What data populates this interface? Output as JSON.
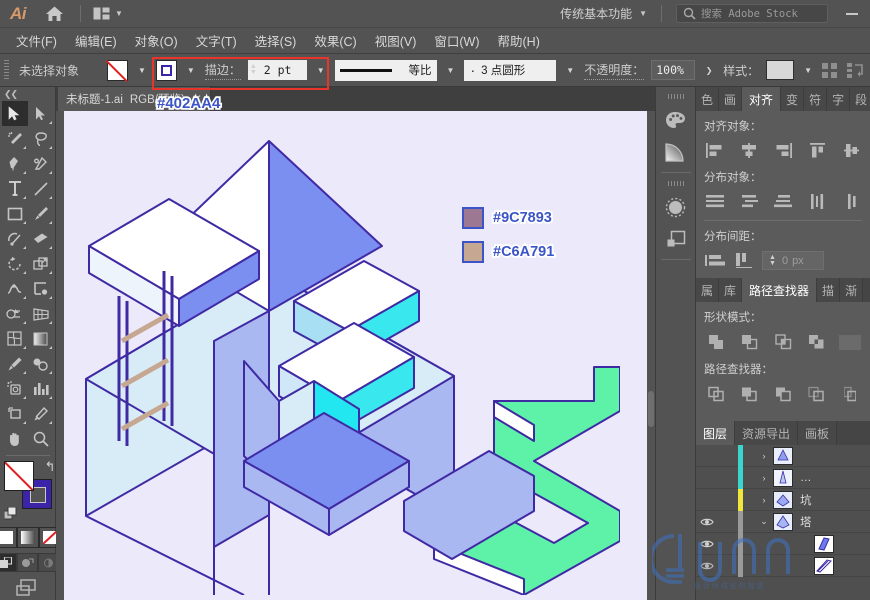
{
  "app": {
    "logo": "Ai",
    "home_icon": "home-icon",
    "arrange_icon": "arrange-documents-icon",
    "workspace": "传统基本功能",
    "search_placeholder": "搜索 Adobe Stock",
    "search_icon": "search-icon",
    "minimize_label": "—"
  },
  "menubar": {
    "items": [
      {
        "label": "文件(F)",
        "name": "menu-file"
      },
      {
        "label": "编辑(E)",
        "name": "menu-edit"
      },
      {
        "label": "对象(O)",
        "name": "menu-object"
      },
      {
        "label": "文字(T)",
        "name": "menu-type"
      },
      {
        "label": "选择(S)",
        "name": "menu-select"
      },
      {
        "label": "效果(C)",
        "name": "menu-effect"
      },
      {
        "label": "视图(V)",
        "name": "menu-view"
      },
      {
        "label": "窗口(W)",
        "name": "menu-window"
      },
      {
        "label": "帮助(H)",
        "name": "menu-help"
      }
    ]
  },
  "controlbar": {
    "selection_status": "未选择对象",
    "fill_swatch": "none",
    "stroke_label": "描边：",
    "stroke_width": "2 pt",
    "profile_label": "等比",
    "brush_label": "3 点圆形",
    "opacity_label": "不透明度：",
    "opacity_value": "100%",
    "style_label": "样式：",
    "align_icon": "align-panel-icon",
    "transform_icon": "transform-panel-icon"
  },
  "document": {
    "tab_title": "未标题-1.ai",
    "tab_mode": "RGB/预览)",
    "tab_close": "✕",
    "hex_annotation": "#402AA4"
  },
  "canvas": {
    "background": "#ece9fb",
    "stroke_color": "#402AA4",
    "legend": [
      {
        "hex": "#9C7893",
        "swatch": "#9C7893"
      },
      {
        "hex": "#C6A791",
        "swatch": "#C6A791"
      }
    ]
  },
  "toolbar": {
    "collapse_icon": "collapse-toolbar-icon",
    "tools": [
      {
        "name": "selection-tool",
        "active": true
      },
      {
        "name": "direct-selection-tool",
        "active": false
      },
      {
        "name": "magic-wand-tool",
        "active": false
      },
      {
        "name": "lasso-tool",
        "active": false
      },
      {
        "name": "pen-tool",
        "active": false
      },
      {
        "name": "curvature-tool",
        "active": false
      },
      {
        "name": "type-tool",
        "active": false
      },
      {
        "name": "line-segment-tool",
        "active": false
      },
      {
        "name": "rectangle-tool",
        "active": false
      },
      {
        "name": "paintbrush-tool",
        "active": false
      },
      {
        "name": "shaper-tool",
        "active": false
      },
      {
        "name": "eraser-tool",
        "active": false
      },
      {
        "name": "rotate-tool",
        "active": false
      },
      {
        "name": "scale-tool",
        "active": false
      },
      {
        "name": "width-tool",
        "active": false
      },
      {
        "name": "free-transform-tool",
        "active": false
      },
      {
        "name": "shape-builder-tool",
        "active": false
      },
      {
        "name": "perspective-grid-tool",
        "active": false
      },
      {
        "name": "mesh-tool",
        "active": false
      },
      {
        "name": "gradient-tool",
        "active": false
      },
      {
        "name": "eyedropper-tool",
        "active": false
      },
      {
        "name": "blend-tool",
        "active": false
      },
      {
        "name": "symbol-sprayer-tool",
        "active": false
      },
      {
        "name": "column-graph-tool",
        "active": false
      },
      {
        "name": "artboard-tool",
        "active": false
      },
      {
        "name": "slice-tool",
        "active": false
      },
      {
        "name": "hand-tool",
        "active": false
      },
      {
        "name": "zoom-tool",
        "active": false
      }
    ],
    "fill_color": "none",
    "stroke_color": "#3c24a8",
    "swap_icon": "swap-fill-stroke-icon",
    "default_icon": "default-fill-stroke-icon",
    "color_modes": [
      "color-mode-icon",
      "gradient-mode-icon",
      "none-mode-icon"
    ],
    "draw_modes": [
      "draw-normal-icon",
      "draw-behind-icon",
      "draw-inside-icon"
    ],
    "screen_mode": "screen-mode-icon"
  },
  "icon_dock": {
    "icons": [
      {
        "name": "color-palette-icon"
      },
      {
        "name": "gradient-icon"
      },
      {
        "name": "brushes-icon"
      },
      {
        "name": "symbols-icon"
      }
    ]
  },
  "align_panel": {
    "tabs": [
      {
        "label": "色",
        "name": "tab-color",
        "active": false
      },
      {
        "label": "画",
        "name": "tab-artboard",
        "active": false
      },
      {
        "label": "对齐",
        "name": "tab-align",
        "active": true
      },
      {
        "label": "变",
        "name": "tab-transform",
        "active": false
      },
      {
        "label": "符",
        "name": "tab-symbols",
        "active": false
      },
      {
        "label": "字",
        "name": "tab-character",
        "active": false
      },
      {
        "label": "段",
        "name": "tab-paragraph",
        "active": false
      }
    ],
    "align_objects_label": "对齐对象：",
    "distribute_objects_label": "分布对象：",
    "distribute_spacing_label": "分布间距：",
    "spacing_value": "0",
    "spacing_unit": "px",
    "align_buttons": [
      "align-left-icon",
      "align-horizontal-center-icon",
      "align-right-icon",
      "align-top-icon",
      "align-vertical-center-icon"
    ],
    "distribute_buttons": [
      "distribute-top-icon",
      "distribute-vertical-center-icon",
      "distribute-bottom-icon",
      "distribute-left-icon",
      "distribute-horizontal-center-icon"
    ],
    "spacing_buttons": [
      "vertical-distribute-space-icon",
      "horizontal-distribute-space-icon"
    ]
  },
  "pathfinder_panel": {
    "tabs": [
      {
        "label": "属",
        "name": "tab-attributes",
        "active": false
      },
      {
        "label": "库",
        "name": "tab-libraries",
        "active": false
      },
      {
        "label": "路径查找器",
        "name": "tab-pathfinder",
        "active": true
      },
      {
        "label": "描",
        "name": "tab-stroke",
        "active": false
      },
      {
        "label": "渐",
        "name": "tab-gradient",
        "active": false
      }
    ],
    "shape_modes_label": "形状模式：",
    "pathfinders_label": "路径查找器：",
    "shape_mode_buttons": [
      "unite-icon",
      "minus-front-icon",
      "intersect-icon",
      "exclude-icon",
      "expand-button"
    ],
    "pathfinder_buttons": [
      "divide-icon",
      "trim-icon",
      "merge-icon",
      "crop-icon",
      "outline-icon"
    ]
  },
  "layers_panel": {
    "tabs": [
      {
        "label": "图层",
        "name": "tab-layers",
        "active": true
      },
      {
        "label": "资源导出",
        "name": "tab-asset-export",
        "active": false
      },
      {
        "label": "画板",
        "name": "tab-artboards",
        "active": false
      }
    ],
    "rows": [
      {
        "name": "",
        "color": "#3ad6cd",
        "visible": false,
        "expanded": false,
        "indent": 0,
        "arrow": "›"
      },
      {
        "name": "…",
        "color": "#3ad6cd",
        "visible": false,
        "expanded": false,
        "indent": 0,
        "arrow": "›"
      },
      {
        "name": "坑",
        "color": "#f2e53c",
        "visible": false,
        "expanded": false,
        "indent": 0,
        "arrow": "›"
      },
      {
        "name": "塔",
        "color": "#9a9a9a",
        "visible": true,
        "expanded": true,
        "indent": 0,
        "arrow": "⌄"
      },
      {
        "name": "",
        "color": "#9a9a9a",
        "visible": true,
        "expanded": false,
        "indent": 1,
        "arrow": ""
      },
      {
        "name": "",
        "color": "#9a9a9a",
        "visible": true,
        "expanded": false,
        "indent": 1,
        "arrow": ""
      }
    ]
  }
}
